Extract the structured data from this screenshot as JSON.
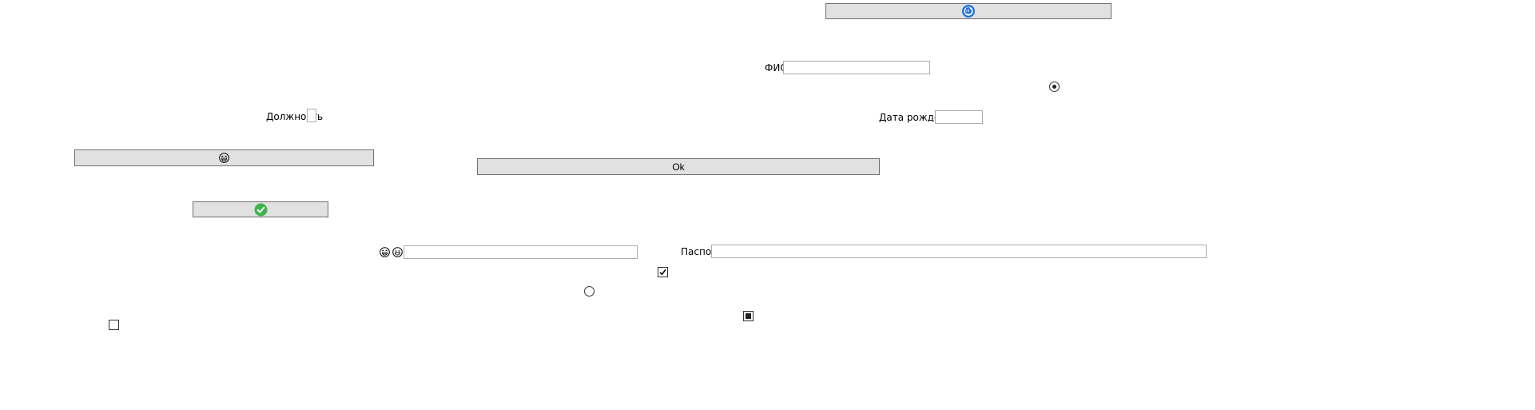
{
  "labels": {
    "fio": "ФИО",
    "position": "Должность",
    "birth_date": "Дата рождения",
    "passport": "Паспорт"
  },
  "buttons": {
    "ok": "Ok"
  },
  "fields": {
    "fio": "",
    "position": "",
    "birth_date": "",
    "passport": "",
    "emoji_field": ""
  },
  "states": {
    "radio_top": "checked",
    "radio_middle": "unchecked",
    "checkbox_middle": "checked",
    "checkbox_bottom_right": "indeterminate",
    "checkbox_bottom_left": "unchecked"
  },
  "icons": {
    "top_button": "refresh-hand-icon",
    "wide_left_button": "grin-emoji-icon",
    "small_left_button": "check-circle-icon",
    "emoji_1": "grin-emoji-icon",
    "emoji_2": "smile-emoji-icon"
  },
  "colors": {
    "button_bg": "#e1e1e1",
    "button_border": "#707070",
    "field_border": "#abadb3",
    "accent_blue": "#1e6fd9",
    "accent_green": "#3cb44b"
  }
}
